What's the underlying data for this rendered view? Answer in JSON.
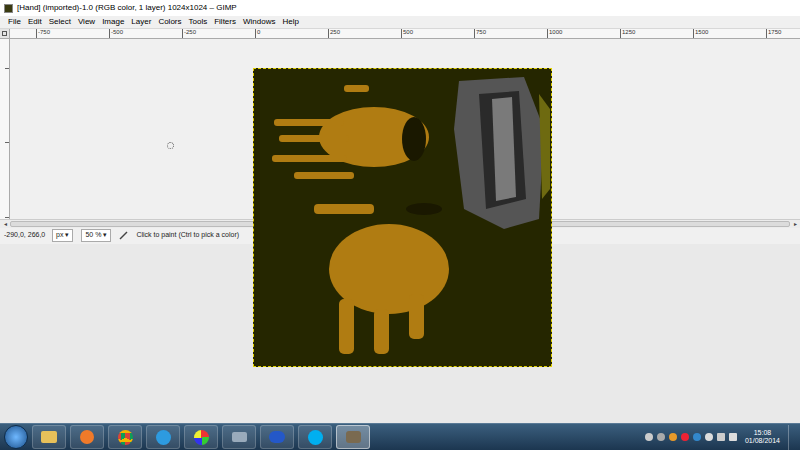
{
  "window": {
    "title": "[Hand] (imported)-1.0 (RGB color, 1 layer) 1024x1024 – GIMP"
  },
  "menu": [
    "File",
    "Edit",
    "Select",
    "View",
    "Image",
    "Layer",
    "Colors",
    "Tools",
    "Filters",
    "Windows",
    "Help"
  ],
  "ruler": {
    "ticks": [
      "-750",
      "-500",
      "-250",
      "0",
      "250",
      "500",
      "750",
      "1000",
      "1250",
      "1500",
      "1750"
    ]
  },
  "status_bar": {
    "coords": "-290,0, 266,0",
    "unit": "px",
    "zoom": "50 %",
    "arrow": "▾",
    "message": "Click to paint (Ctrl to pick a color)"
  },
  "taskbar": {
    "time": "15:08",
    "date": "01/08/2014"
  }
}
